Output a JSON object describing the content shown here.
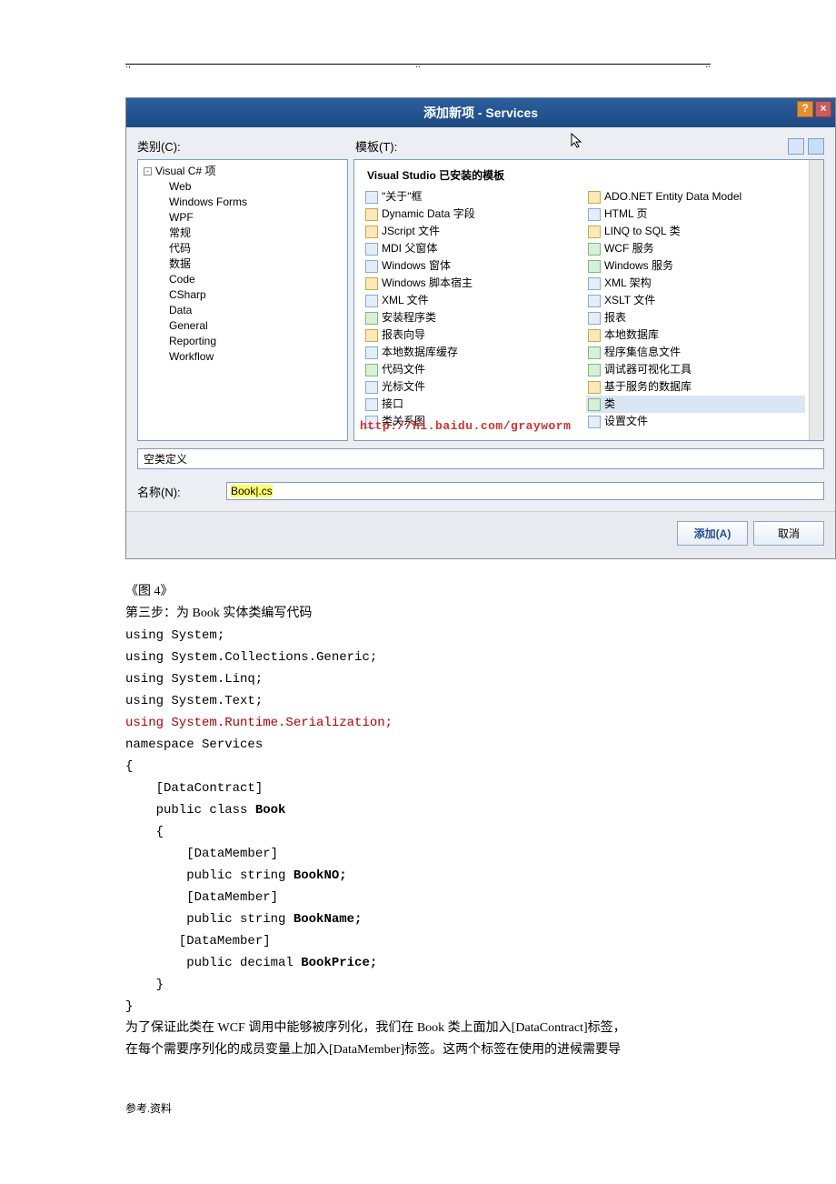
{
  "header_marks": [
    ".,",
    "..",
    ".."
  ],
  "dialog": {
    "title": "添加新项 - Services",
    "label_category": "类别(C):",
    "label_template": "模板(T):",
    "tree_root": "Visual C# 项",
    "tree_children": [
      "Web",
      "Windows Forms",
      "WPF",
      "常规",
      "代码",
      "数据",
      "Code",
      "CSharp",
      "Data",
      "General",
      "Reporting",
      "Workflow"
    ],
    "templates_header": "Visual Studio 已安装的模板",
    "templates_col1": [
      "\"关于\"框",
      "Dynamic Data 字段",
      "JScript 文件",
      "MDI 父窗体",
      "Windows 窗体",
      "Windows 脚本宿主",
      "XML 文件",
      "安装程序类",
      "报表向导",
      "本地数据库缓存",
      "代码文件",
      "光标文件",
      "接口",
      "类关系图"
    ],
    "templates_col2": [
      "ADO.NET Entity Data Model",
      "HTML 页",
      "LINQ to SQL 类",
      "WCF 服务",
      "Windows 服务",
      "XML 架构",
      "XSLT 文件",
      "报表",
      "本地数据库",
      "程序集信息文件",
      "调试器可视化工具",
      "基于服务的数据库",
      "类",
      "设置文件"
    ],
    "selected_template": "类",
    "watermark": "http://hi.baidu.com/grayworm",
    "description": "空类定义",
    "name_label": "名称(N):",
    "name_value": "Book|.cs",
    "btn_add": "添加(A)",
    "btn_cancel": "取消"
  },
  "body": {
    "fig_caption": "《图 4》",
    "step3_title": "第三步：为 Book 实体类编写代码",
    "code_lines": [
      "using System;",
      "using System.Collections.Generic;",
      "using System.Linq;",
      "using System.Text;"
    ],
    "code_hl": "using System.Runtime.Serialization;",
    "code_ns": "namespace Services",
    "brace_open": "{",
    "attr_datacontract": "    [DataContract]",
    "class_decl_a": "    public class ",
    "class_decl_b": "Book",
    "brace_open2": "    {",
    "attr_dm": "        [DataMember]",
    "field1_a": "        public string ",
    "field1_b": "BookNO;",
    "field2_a": "        public string ",
    "field2_b": "BookName;",
    "attr_dm3_a": "       [DataMember]",
    "field3_a": "        public decimal ",
    "field3_b": "BookPrice;",
    "brace_close2": "    }",
    "brace_close": "}",
    "para1": "为了保证此类在 WCF 调用中能够被序列化，我们在 Book 类上面加入[DataContract]标签，",
    "para2": "在每个需要序列化的成员变量上加入[DataMember]标签。这两个标签在使用的进候需要导",
    "footer": "参考.资料"
  }
}
